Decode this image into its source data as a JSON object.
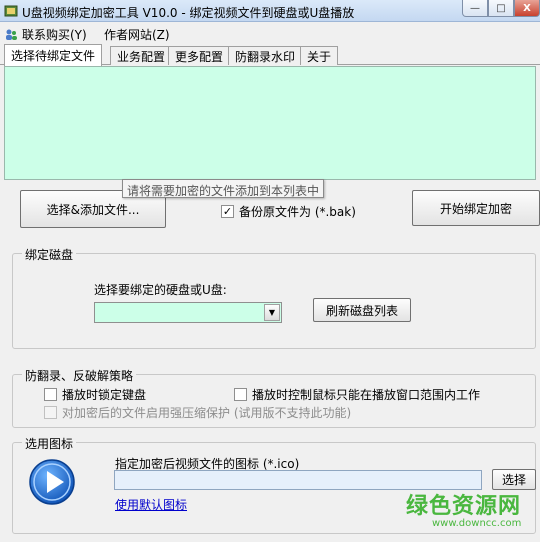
{
  "window": {
    "title": "U盘视频绑定加密工具 V10.0 - 绑定视频文件到硬盘或U盘播放",
    "minimize_label": "—",
    "maximize_label": "□",
    "close_label": "X"
  },
  "menu": {
    "items": [
      {
        "label": "联系购买(Y)"
      },
      {
        "label": "作者网站(Z)"
      }
    ]
  },
  "tabs": [
    {
      "label": "选择待绑定文件",
      "active": true
    },
    {
      "label": "业务配置"
    },
    {
      "label": "更多配置"
    },
    {
      "label": "防翻录水印"
    },
    {
      "label": "关于"
    }
  ],
  "file_list": {
    "tooltip": "请将需要加密的文件添加到本列表中"
  },
  "actions": {
    "add_file_label": "选择&添加文件...",
    "backup_label": "备份原文件为 (*.bak)",
    "backup_checked": true,
    "start_label": "开始绑定加密"
  },
  "bind_disk": {
    "group_label": "绑定磁盘",
    "select_label": "选择要绑定的硬盘或U盘:",
    "selected_value": "",
    "refresh_label": "刷新磁盘列表"
  },
  "anti_record": {
    "group_label": "防翻录、反破解策略",
    "options": [
      {
        "label": "播放时锁定键盘",
        "checked": false,
        "enabled": true
      },
      {
        "label": "播放时控制鼠标只能在播放窗口范围内工作",
        "checked": false,
        "enabled": true
      },
      {
        "label": "对加密后的文件启用强压缩保护 (试用版不支持此功能)",
        "checked": false,
        "enabled": false
      }
    ]
  },
  "icon_select": {
    "group_label": "选用图标",
    "field_label": "指定加密后视频文件的图标 (*.ico)",
    "path_value": "",
    "choose_label": "选择",
    "default_link": "使用默认图标"
  },
  "watermark": {
    "title": "绿色资源网",
    "url": "www.downcc.com"
  },
  "colors": {
    "list_bg": "#ccffe8",
    "accent_blue": "#1c6fd8",
    "watermark_green": "#4ab73f"
  }
}
